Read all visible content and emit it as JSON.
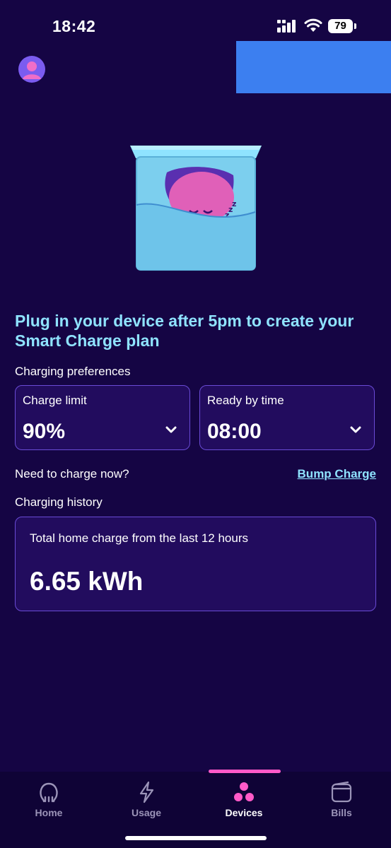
{
  "status_bar": {
    "time": "18:42",
    "battery": "79"
  },
  "header": {
    "avatar_icon": "user-icon"
  },
  "headline": "Plug in your device after 5pm to create your Smart Charge plan",
  "preferences": {
    "section_label": "Charging preferences",
    "charge_limit": {
      "label": "Charge limit",
      "value": "90%"
    },
    "ready_by": {
      "label": "Ready by time",
      "value": "08:00"
    }
  },
  "charge_now": {
    "question": "Need to charge now?",
    "action": "Bump Charge"
  },
  "history": {
    "section_label": "Charging history",
    "description": "Total home charge from the last 12 hours",
    "value": "6.65 kWh"
  },
  "nav": {
    "items": [
      {
        "label": "Home",
        "icon": "octopus-icon"
      },
      {
        "label": "Usage",
        "icon": "lightning-icon"
      },
      {
        "label": "Devices",
        "icon": "devices-icon"
      },
      {
        "label": "Bills",
        "icon": "wallet-icon"
      }
    ],
    "active": "Devices"
  },
  "colors": {
    "background": "#150544",
    "headline": "#8fe3ff",
    "card_border": "#6a4bd6",
    "accent_pink": "#ff5ac8",
    "blue_block": "#3c7ff0"
  }
}
